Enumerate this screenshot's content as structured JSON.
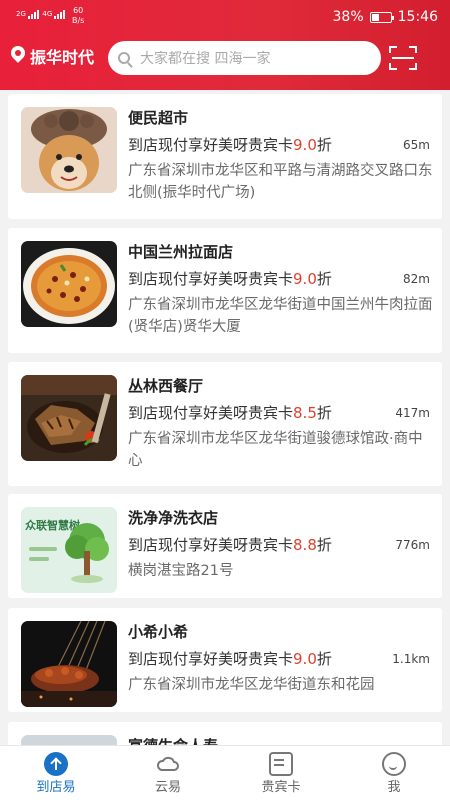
{
  "status_bar": {
    "signal_left": "2G",
    "signal_right": "4G",
    "speed_value": "60",
    "speed_unit": "B/s",
    "battery": "38%",
    "time": "15:46"
  },
  "header": {
    "location": "振华时代",
    "search_placeholder": "大家都在搜  四海一家"
  },
  "stores": [
    {
      "name": "便民超市",
      "offer_prefix": "到店现付享好美呀贵宾卡",
      "discount": "9.0",
      "offer_suffix": "折",
      "distance": "65m",
      "address": "广东省深圳市龙华区和平路与清湖路交叉路口东北侧(振华时代广场)",
      "image": "dog-in-hat-photo"
    },
    {
      "name": "中国兰州拉面店",
      "offer_prefix": "到店现付享好美呀贵宾卡",
      "discount": "9.0",
      "offer_suffix": "折",
      "distance": "82m",
      "address": "广东省深圳市龙华区龙华街道中国兰州牛肉拉面(贤华店)贤华大厦",
      "image": "noodle-bowl-photo"
    },
    {
      "name": "丛林西餐厅",
      "offer_prefix": "到店现付享好美呀贵宾卡",
      "discount": "8.5",
      "offer_suffix": "折",
      "distance": "417m",
      "address": "广东省深圳市龙华区龙华街道骏德球馆政·商中心",
      "image": "steak-plate-photo"
    },
    {
      "name": "洗净净洗衣店",
      "offer_prefix": "到店现付享好美呀贵宾卡",
      "discount": "8.8",
      "offer_suffix": "折",
      "distance": "776m",
      "address": "横岗湛宝路21号",
      "image": "tree-logo-illustration",
      "image_text": "众联智慧树"
    },
    {
      "name": "小希小希",
      "offer_prefix": "到店现付享好美呀贵宾卡",
      "discount": "9.0",
      "offer_suffix": "折",
      "distance": "1.1km",
      "address": "广东省深圳市龙华区龙华街道东和花园",
      "image": "bbq-skewers-photo"
    },
    {
      "name": "富德生命人寿",
      "image": "office-photo"
    }
  ],
  "tabs": [
    {
      "label": "到店易",
      "icon": "upload-arrow-icon",
      "active": true
    },
    {
      "label": "云易",
      "icon": "cloud-icon",
      "active": false
    },
    {
      "label": "贵宾卡",
      "icon": "card-document-icon",
      "active": false
    },
    {
      "label": "我",
      "icon": "smiley-face-icon",
      "active": false
    }
  ],
  "colors": {
    "header_red": "#e8203a",
    "discount_red": "#e0412e",
    "active_tab_blue": "#1a72c6"
  }
}
